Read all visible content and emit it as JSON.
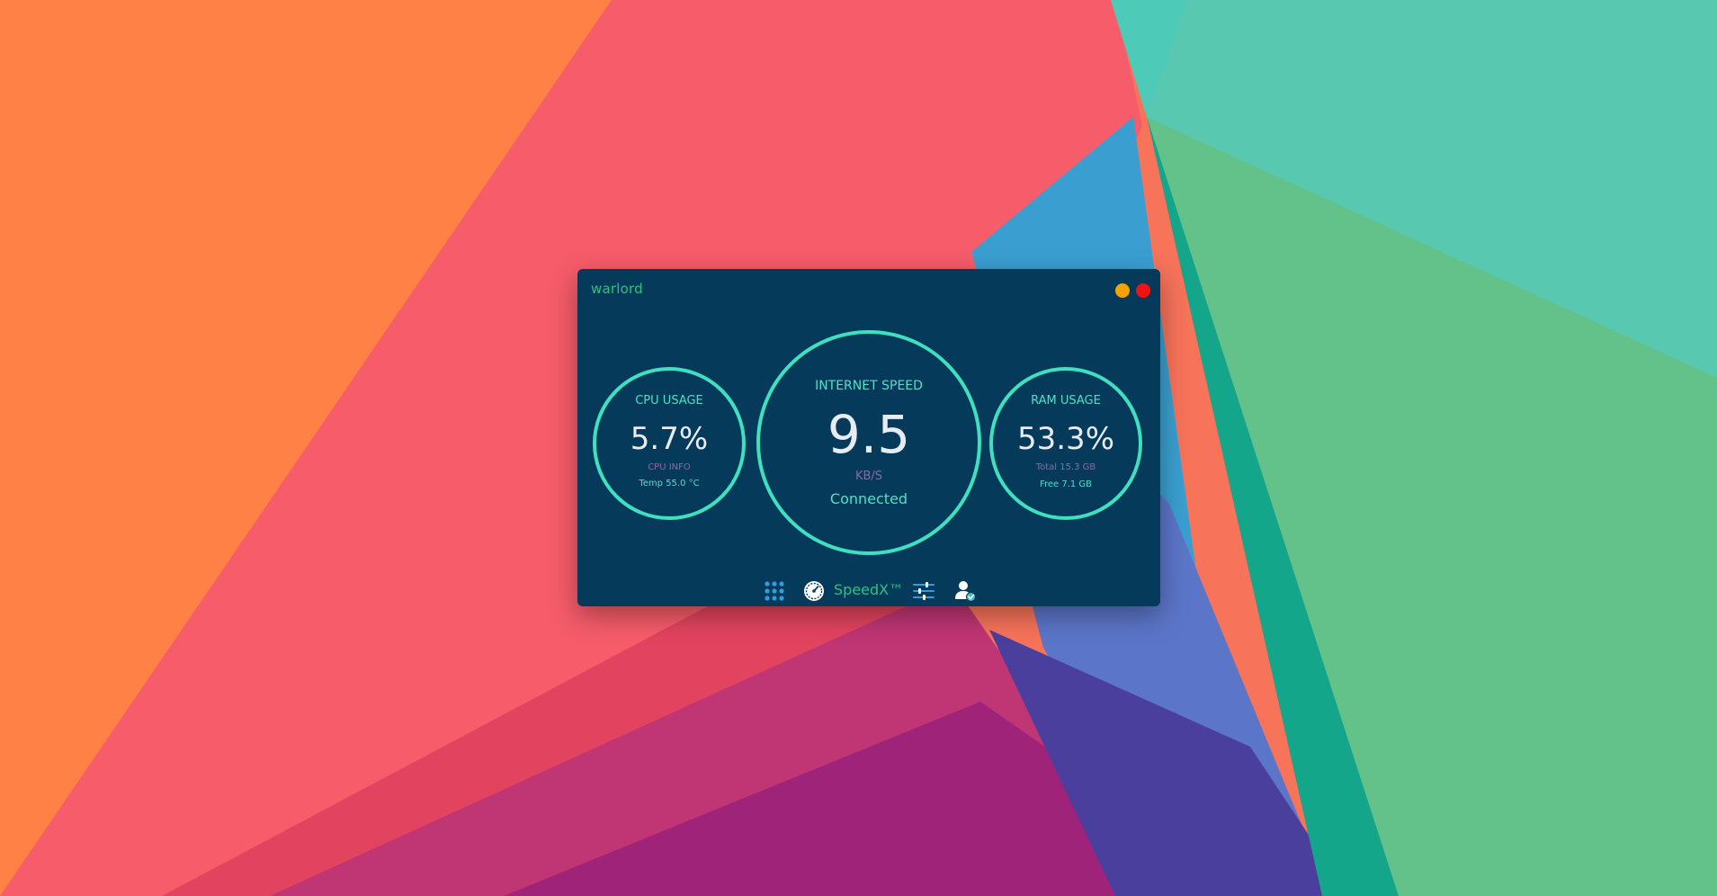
{
  "window": {
    "title": "warlord",
    "buttons": {
      "minimize_color": "#f6a200",
      "close_color": "#f01313"
    }
  },
  "gauges": {
    "cpu": {
      "label": "CPU USAGE",
      "value": "5.7%",
      "sub": "CPU INFO",
      "info": "Temp 55.0 °C"
    },
    "internet": {
      "label": "INTERNET SPEED",
      "value": "9.5",
      "unit": "KB/S",
      "status": "Connected"
    },
    "ram": {
      "label": "RAM USAGE",
      "value": "53.3%",
      "total": "Total 15.3 GB",
      "free": "Free 7.1 GB"
    }
  },
  "toolbar": {
    "brand": "SpeedX™",
    "icons": [
      "apps-grid-icon",
      "speedometer-icon",
      "settings-sliders-icon",
      "user-verified-icon"
    ]
  },
  "colors": {
    "widget_bg": "#063a5a",
    "accent_ring": "#3fe0c0",
    "accent_green": "#2ec27e",
    "muted_purple": "#8a6aa6"
  }
}
